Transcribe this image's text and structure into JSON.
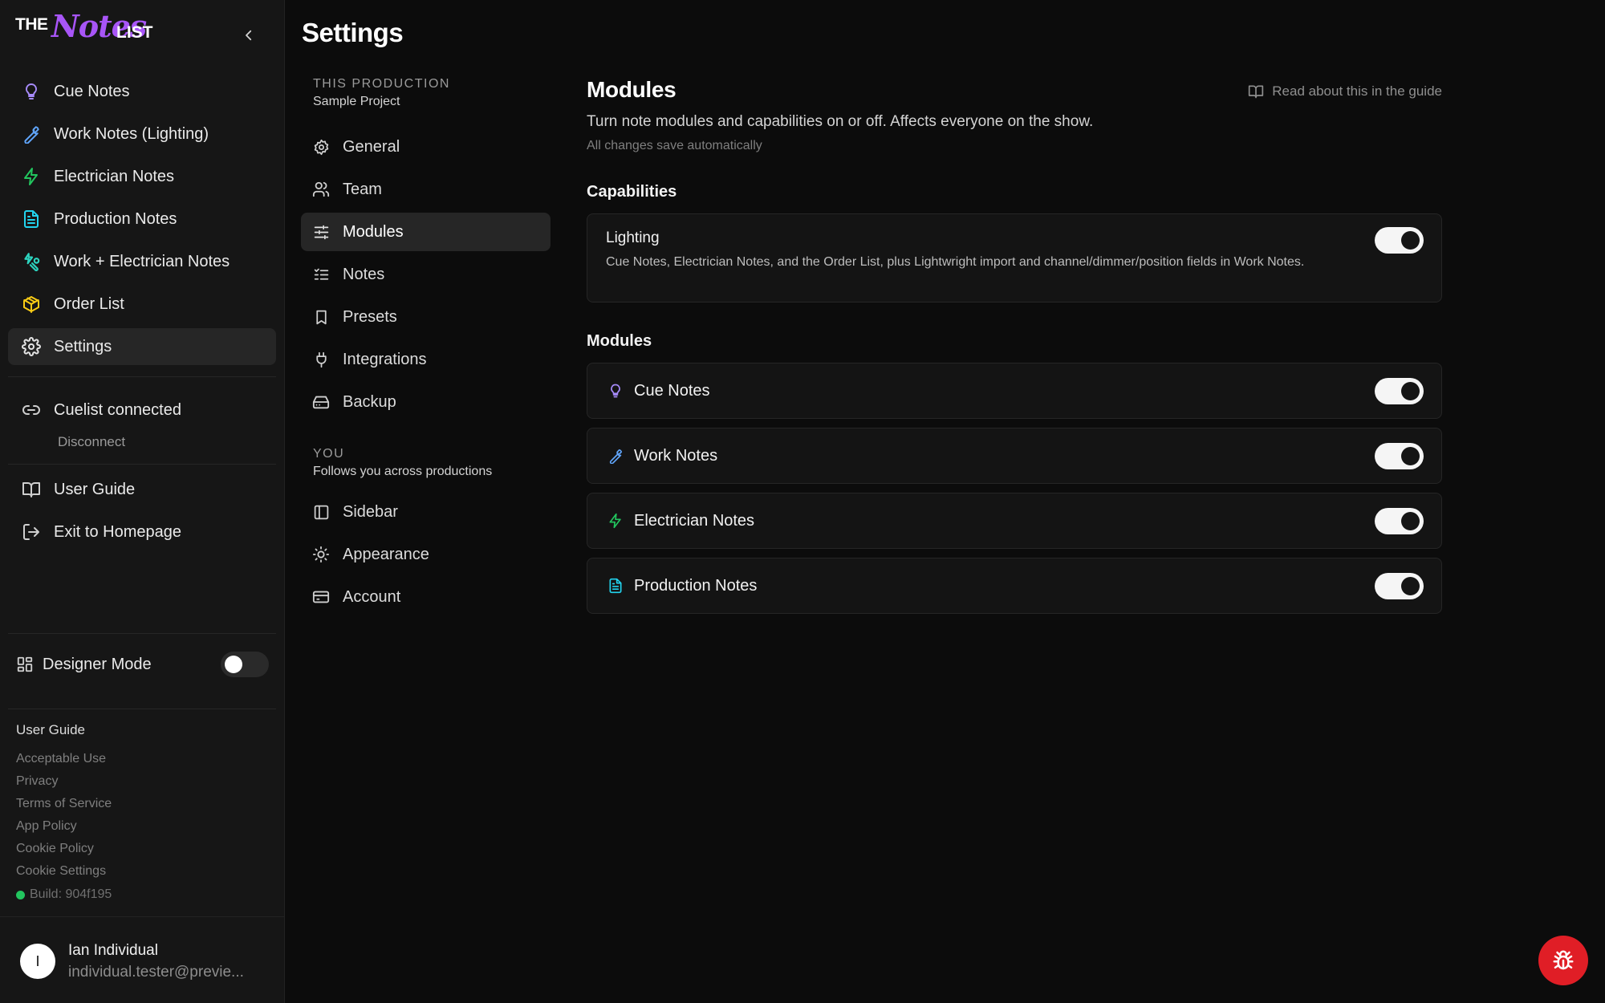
{
  "brand": {
    "logo_the": "THE",
    "logo_notes": "Notes",
    "logo_list": "LIST",
    "accent": "#a855f7"
  },
  "sidebar": {
    "items": [
      {
        "label": "Cue Notes",
        "icon": "lightbulb-icon",
        "color": "#a78bfa"
      },
      {
        "label": "Work Notes (Lighting)",
        "icon": "wrench-icon",
        "color": "#60a5fa"
      },
      {
        "label": "Electrician Notes",
        "icon": "bolt-icon",
        "color": "#22c55e"
      },
      {
        "label": "Production Notes",
        "icon": "document-icon",
        "color": "#22d3ee"
      },
      {
        "label": "Work + Electrician Notes",
        "icon": "wrench-bolt-icon",
        "color": "#2dd4bf"
      },
      {
        "label": "Order List",
        "icon": "box-icon",
        "color": "#facc15"
      },
      {
        "label": "Settings",
        "icon": "gear-icon",
        "color": "#e5e5e5"
      }
    ],
    "cuelist": {
      "label": "Cuelist connected",
      "action": "Disconnect"
    },
    "lower": [
      {
        "label": "User Guide",
        "icon": "book-icon"
      },
      {
        "label": "Exit to Homepage",
        "icon": "exit-icon"
      }
    ],
    "designer_mode": {
      "label": "Designer Mode",
      "enabled": false
    },
    "footer": {
      "heading": "User Guide",
      "links": [
        "Acceptable Use",
        "Privacy",
        "Terms of Service",
        "App Policy",
        "Cookie Policy",
        "Cookie Settings"
      ],
      "build": "Build: 904f195"
    },
    "user": {
      "initial": "I",
      "name": "Ian Individual",
      "email": "individual.tester@previe..."
    }
  },
  "settings": {
    "title": "Settings",
    "production_label": "THIS PRODUCTION",
    "production_name": "Sample Project",
    "production_items": [
      "General",
      "Team",
      "Modules",
      "Notes",
      "Presets",
      "Integrations",
      "Backup"
    ],
    "active_item": "Modules",
    "you_label": "YOU",
    "you_sub": "Follows you across productions",
    "you_items": [
      "Sidebar",
      "Appearance",
      "Account"
    ]
  },
  "main": {
    "title": "Modules",
    "guide_link": "Read about this in the guide",
    "description": "Turn note modules and capabilities on or off. Affects everyone on the show.",
    "autosave": "All changes save automatically",
    "capabilities_heading": "Capabilities",
    "capability": {
      "title": "Lighting",
      "description": "Cue Notes, Electrician Notes, and the Order List, plus Lightwright import and channel/dimmer/position fields in Work Notes.",
      "enabled": true
    },
    "modules_heading": "Modules",
    "modules": [
      {
        "label": "Cue Notes",
        "icon": "lightbulb-icon",
        "color": "#a78bfa",
        "enabled": true
      },
      {
        "label": "Work Notes",
        "icon": "wrench-icon",
        "color": "#60a5fa",
        "enabled": true
      },
      {
        "label": "Electrician Notes",
        "icon": "bolt-icon",
        "color": "#22c55e",
        "enabled": true
      },
      {
        "label": "Production Notes",
        "icon": "document-icon",
        "color": "#22d3ee",
        "enabled": true
      }
    ]
  },
  "bug_report": {
    "icon": "bug-icon",
    "color": "#e01e26"
  }
}
